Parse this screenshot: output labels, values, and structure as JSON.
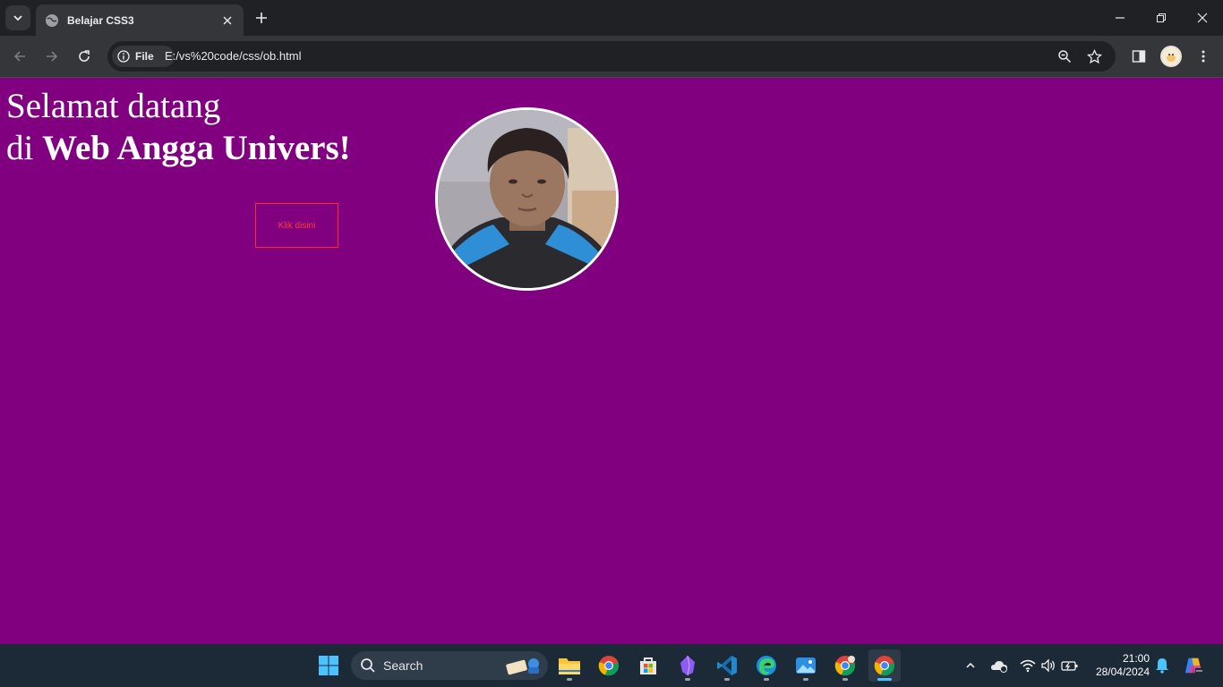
{
  "browser": {
    "tab_title": "Belajar CSS3",
    "chip_label": "File",
    "url": "E:/vs%20code/css/ob.html",
    "icons": [
      "tab-search-icon",
      "globe-icon",
      "close-icon",
      "plus-icon",
      "minimize-icon",
      "restore-icon",
      "window-close-icon",
      "back-icon",
      "forward-icon",
      "reload-icon",
      "info-icon",
      "zoom-icon",
      "star-icon",
      "side-panel-icon",
      "profile-avatar",
      "kebab-menu-icon"
    ]
  },
  "page": {
    "background": "#800080",
    "heading_line1": "Selamat datang",
    "heading_prefix": "di",
    "heading_bold": "Web Angga Univers!",
    "button_label": "Klik disini",
    "button_color": "#ff3b3b",
    "image": "profile-photo-circle"
  },
  "taskbar": {
    "search_label": "Search",
    "apps": [
      "windows-start-icon",
      "file-explorer-icon",
      "chrome-icon",
      "microsoft-store-icon",
      "obsidian-icon",
      "vscode-icon",
      "edge-icon",
      "photos-icon",
      "chrome-profile-icon",
      "chrome-active-icon"
    ],
    "tray": [
      "chevron-up-icon",
      "onedrive-icon",
      "wifi-icon",
      "volume-icon",
      "battery-icon",
      "bell-icon",
      "copilot-icon"
    ],
    "time": "21:00",
    "date": "28/04/2024"
  }
}
